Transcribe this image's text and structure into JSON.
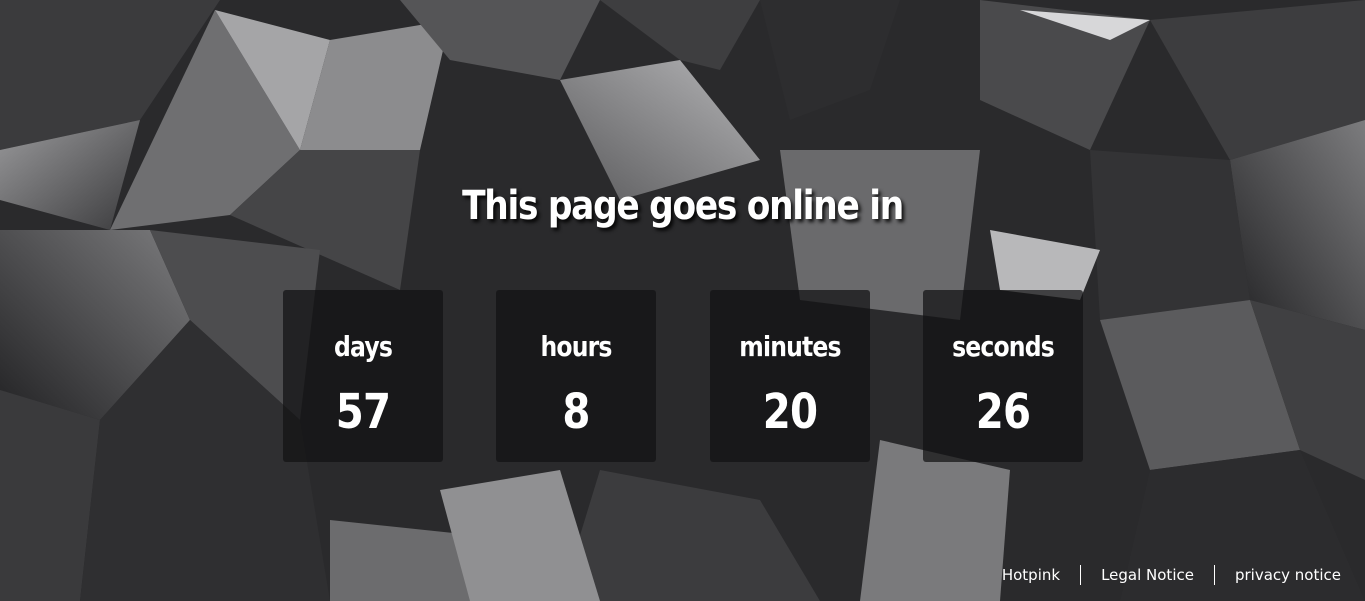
{
  "headline": "This page goes online in",
  "countdown": {
    "units": [
      {
        "label": "days",
        "value": "57"
      },
      {
        "label": "hours",
        "value": "8"
      },
      {
        "label": "minutes",
        "value": "20"
      },
      {
        "label": "seconds",
        "value": "26"
      }
    ]
  },
  "footer": {
    "links": [
      {
        "label": "Hotpink"
      },
      {
        "label": "Legal Notice"
      },
      {
        "label": "privacy notice"
      }
    ]
  },
  "colors": {
    "text": "#ffffff",
    "box_background": "#121214",
    "background_dark": "#1a1a1c",
    "background_light": "#8a8a8c"
  }
}
